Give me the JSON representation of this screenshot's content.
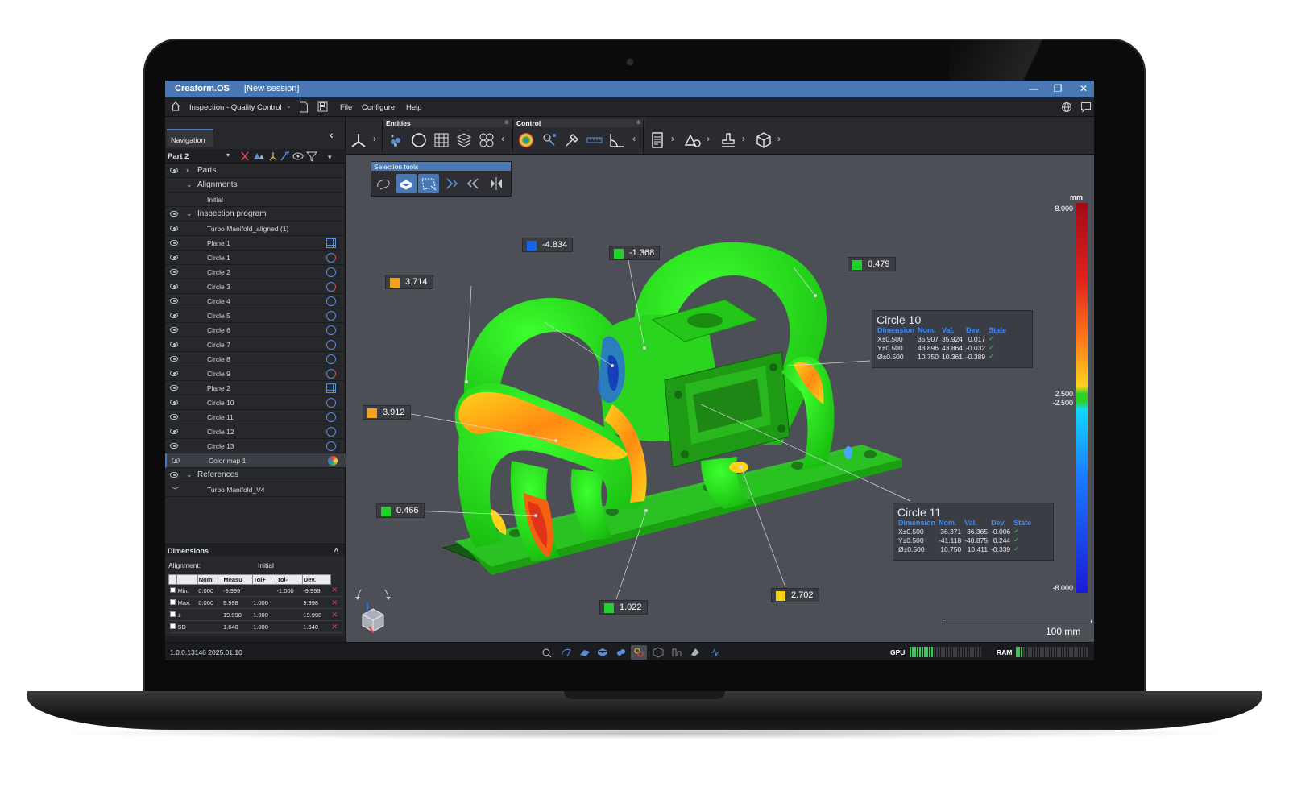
{
  "window": {
    "app_name": "Creaform.OS",
    "session": "[New session]",
    "buttons": {
      "minimize": "—",
      "maximize": "❐",
      "close": "✕"
    }
  },
  "menubar": {
    "workspace": "Inspection - Quality Control",
    "items": [
      "File",
      "Configure",
      "Help"
    ]
  },
  "navigation": {
    "tab_label": "Navigation",
    "part_selector": "Part 2",
    "tree": [
      {
        "label": "Parts",
        "eye": true,
        "chevron": "›",
        "level": 0,
        "big": true
      },
      {
        "label": "Alignments",
        "eye": false,
        "chevron": "⌄",
        "level": 0,
        "big": true
      },
      {
        "label": "Initial",
        "eye": false,
        "level": 2
      },
      {
        "label": "Inspection program",
        "eye": true,
        "chevron": "⌄",
        "level": 0,
        "big": true
      },
      {
        "label": "Turbo Manifold_aligned (1)",
        "eye": true,
        "level": 1
      },
      {
        "label": "Plane 1",
        "eye": true,
        "level": 1,
        "icon": "plane"
      },
      {
        "label": "Circle 1",
        "eye": true,
        "level": 1,
        "icon": "circle-warn"
      },
      {
        "label": "Circle 2",
        "eye": true,
        "level": 1,
        "icon": "circle"
      },
      {
        "label": "Circle 3",
        "eye": true,
        "level": 1,
        "icon": "circle-warn"
      },
      {
        "label": "Circle 4",
        "eye": true,
        "level": 1,
        "icon": "circle"
      },
      {
        "label": "Circle 5",
        "eye": true,
        "level": 1,
        "icon": "circle"
      },
      {
        "label": "Circle 6",
        "eye": true,
        "level": 1,
        "icon": "circle"
      },
      {
        "label": "Circle 7",
        "eye": true,
        "level": 1,
        "icon": "circle"
      },
      {
        "label": "Circle 8",
        "eye": true,
        "level": 1,
        "icon": "circle"
      },
      {
        "label": "Circle 9",
        "eye": true,
        "level": 1,
        "icon": "circle-warn"
      },
      {
        "label": "Plane 2",
        "eye": true,
        "level": 1,
        "icon": "plane"
      },
      {
        "label": "Circle 10",
        "eye": true,
        "level": 1,
        "icon": "circle"
      },
      {
        "label": "Circle 11",
        "eye": true,
        "level": 1,
        "icon": "circle"
      },
      {
        "label": "Circle 12",
        "eye": true,
        "level": 1,
        "icon": "circle"
      },
      {
        "label": "Circle 13",
        "eye": true,
        "level": 1,
        "icon": "circle"
      },
      {
        "label": "Color map 1",
        "eye": true,
        "level": 1,
        "icon": "colormap",
        "selected": true
      },
      {
        "label": "References",
        "eye": true,
        "chevron": "⌄",
        "level": 0,
        "big": true
      },
      {
        "label": "Turbo Manifold_V4",
        "eye": false,
        "chevron": "﹀",
        "level": 1
      }
    ]
  },
  "dimensions": {
    "title": "Dimensions",
    "alignment_label": "Alignment:",
    "alignment_value": "Initial",
    "columns": [
      "",
      "",
      "Nomi",
      "Measu",
      "Tol+",
      "Tol-",
      "Dev."
    ],
    "rows": [
      {
        "name": "Min.",
        "nom": "0.000",
        "meas": "-9.999",
        "tolp": "",
        "tolm": "-1.000",
        "dev": "-9.999",
        "checked": true
      },
      {
        "name": "Max.",
        "nom": "0.000",
        "meas": "9.998",
        "tolp": "1.000",
        "tolm": "",
        "dev": "9.998",
        "checked": false
      },
      {
        "name": "±",
        "nom": "",
        "meas": "19.998",
        "tolp": "1.000",
        "tolm": "",
        "dev": "19.998",
        "checked": false
      },
      {
        "name": "SD",
        "nom": "",
        "meas": "1.640",
        "tolp": "1.000",
        "tolm": "",
        "dev": "1.640",
        "checked": false
      }
    ]
  },
  "toolbar": {
    "entities_label": "Entities",
    "control_label": "Control"
  },
  "viewport": {
    "selection_tools_label": "Selection tools",
    "callouts": [
      {
        "value": "-4.834",
        "color": "#1565e8"
      },
      {
        "value": "-1.368",
        "color": "#1fd32a"
      },
      {
        "value": "0.479",
        "color": "#1fd32a"
      },
      {
        "value": "3.714",
        "color": "#f5a31a"
      },
      {
        "value": "3.912",
        "color": "#f5a31a"
      },
      {
        "value": "0.466",
        "color": "#1fd32a"
      },
      {
        "value": "1.022",
        "color": "#1fd32a"
      },
      {
        "value": "2.702",
        "color": "#f5d21a"
      }
    ],
    "circle10": {
      "title": "Circle 10",
      "headers": [
        "Dimension",
        "Nom.",
        "Val.",
        "Dev.",
        "State"
      ],
      "rows": [
        [
          "X±0.500",
          "35.907",
          "35.924",
          "0.017",
          "✓"
        ],
        [
          "Y±0.500",
          "43.896",
          "43.864",
          "-0.032",
          "✓"
        ],
        [
          "Ø±0.500",
          "10.750",
          "10.361",
          "-0.389",
          "✓"
        ]
      ]
    },
    "circle11": {
      "title": "Circle 11",
      "headers": [
        "Dimension",
        "Nom.",
        "Val.",
        "Dev.",
        "State"
      ],
      "rows": [
        [
          "X±0.500",
          "36.371",
          "36.365",
          "-0.006",
          "✓"
        ],
        [
          "Y±0.500",
          "-41.118",
          "-40.875",
          "0.244",
          "✓"
        ],
        [
          "Ø±0.500",
          "10.750",
          "10.411",
          "-0.339",
          "✓"
        ]
      ]
    },
    "color_scale": {
      "unit": "mm",
      "labels": [
        "8.000",
        "2.500",
        "-2.500",
        "-8.000"
      ]
    },
    "scale_bar": "100 mm"
  },
  "statusbar": {
    "version": "1.0.0.13146 2025.01.10",
    "gpu_label": "GPU",
    "ram_label": "RAM",
    "gpu_active_bars": 10,
    "ram_active_bars": 3
  }
}
